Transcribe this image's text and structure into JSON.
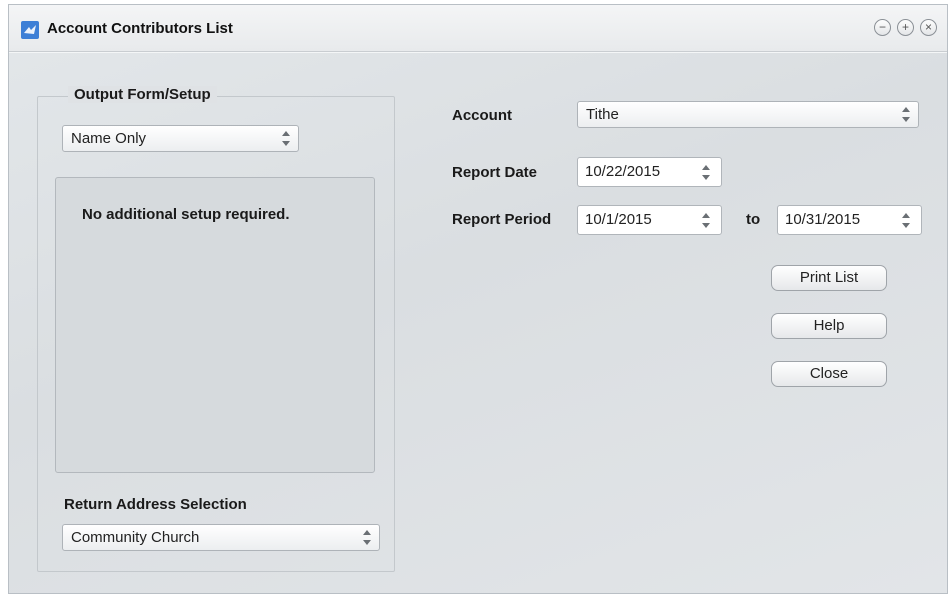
{
  "window": {
    "title": "Account Contributors List",
    "controls": [
      "minimize",
      "maximize",
      "close"
    ]
  },
  "output_form": {
    "legend": "Output Form/Setup",
    "selected": "Name Only",
    "setup_message": "No additional setup required."
  },
  "return_address": {
    "label": "Return Address Selection",
    "selected": "Community Church"
  },
  "account": {
    "label": "Account",
    "selected": "Tithe"
  },
  "report_date": {
    "label": "Report Date",
    "value": "10/22/2015"
  },
  "report_period": {
    "label": "Report Period",
    "from": "10/1/2015",
    "to_label": "to",
    "to": "10/31/2015"
  },
  "buttons": {
    "print_list": "Print List",
    "help": "Help",
    "close": "Close"
  },
  "colors": {
    "app_icon": "#3d7fd6"
  },
  "icons": {
    "minimize": "minus-circle",
    "maximize": "plus-circle",
    "close": "x-circle"
  }
}
